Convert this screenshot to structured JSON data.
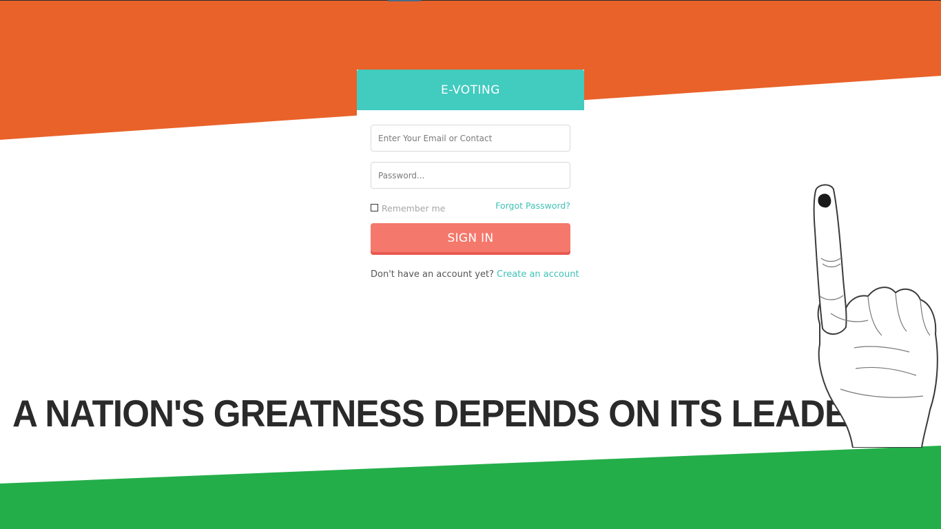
{
  "colors": {
    "saffron": "#e9622a",
    "green": "#24ae4a",
    "header": "#42cbbf",
    "button": "#f4786c",
    "link": "#3ec2b6"
  },
  "login": {
    "title": "E-VOTING",
    "email_placeholder": "Enter Your Email or Contact",
    "password_placeholder": "Password...",
    "remember_label": "Remember me",
    "forgot_label": "Forgot Password?",
    "signin_label": "SIGN IN",
    "no_account_text": "Don't have an account yet? ",
    "create_account_label": "Create an account"
  },
  "banner": {
    "slogan": "A NATION'S GREATNESS DEPENDS ON ITS LEADER",
    "hand_icon": "voting-finger-hand-icon"
  }
}
